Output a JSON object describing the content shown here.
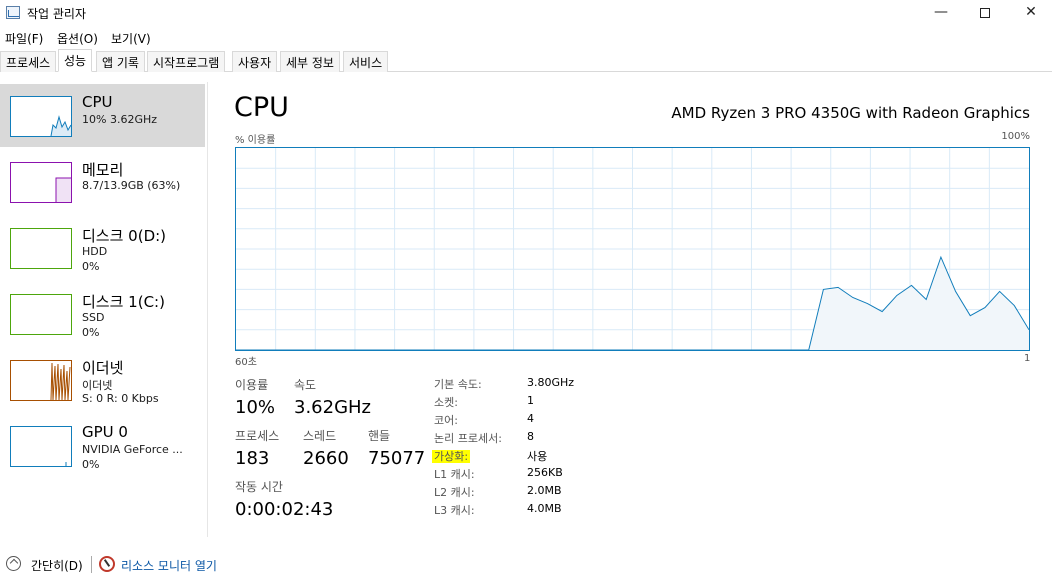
{
  "window": {
    "title": "작업 관리자",
    "controls": {
      "minimize": "—",
      "close": "✕"
    }
  },
  "menu": [
    "파일(F)",
    "옵션(O)",
    "보기(V)"
  ],
  "tabs": [
    "프로세스",
    "성능",
    "앱 기록",
    "시작프로그램",
    "사용자",
    "세부 정보",
    "서비스"
  ],
  "active_tab": "성능",
  "sidebar": {
    "items": [
      {
        "name": "CPU",
        "line1": "10% 3.62GHz",
        "line2": "",
        "color": "#117dbb"
      },
      {
        "name": "메모리",
        "line1": "8.7/13.9GB (63%)",
        "line2": "",
        "color": "#8b12ae"
      },
      {
        "name": "디스크 0(D:)",
        "line1": "HDD",
        "line2": "0%",
        "color": "#4da60c"
      },
      {
        "name": "디스크 1(C:)",
        "line1": "SSD",
        "line2": "0%",
        "color": "#4da60c"
      },
      {
        "name": "이더넷",
        "line1": "이더넷",
        "line2": "S: 0  R: 0 Kbps",
        "color": "#a74f01"
      },
      {
        "name": "GPU 0",
        "line1": "NVIDIA GeForce ...",
        "line2": "0%",
        "color": "#117dbb"
      }
    ]
  },
  "main": {
    "title": "CPU",
    "model": "AMD Ryzen 3 PRO 4350G with Radeon Graphics",
    "graph": {
      "label_left": "% 이용률",
      "label_right": "100%",
      "time_left": "60초",
      "time_right": "1",
      "line_color": "#117dbb",
      "fill_color": "#f1f6fa",
      "grid_color": "#d9eaf7",
      "x_max_seconds": 60,
      "y_max_percent": 100,
      "points": [
        [
          0,
          0
        ],
        [
          39,
          0
        ],
        [
          40,
          30
        ],
        [
          41,
          31
        ],
        [
          42,
          26
        ],
        [
          43,
          23
        ],
        [
          44,
          19
        ],
        [
          45,
          27
        ],
        [
          46,
          32
        ],
        [
          47,
          25
        ],
        [
          48,
          46
        ],
        [
          49,
          29
        ],
        [
          50,
          17
        ],
        [
          51,
          21
        ],
        [
          52,
          29
        ],
        [
          53,
          22
        ],
        [
          54,
          10
        ]
      ]
    },
    "stats": {
      "utilization_label": "이용률",
      "utilization_value": "10%",
      "speed_label": "속도",
      "speed_value": "3.62GHz",
      "process_label": "프로세스",
      "process_value": "183",
      "thread_label": "스레드",
      "thread_value": "2660",
      "handle_label": "핸들",
      "handle_value": "75077",
      "uptime_label": "작동 시간",
      "uptime_value": "0:00:02:43"
    },
    "info": [
      {
        "label": "기본 속도:",
        "value": "3.80GHz"
      },
      {
        "label": "소켓:",
        "value": "1"
      },
      {
        "label": "코어:",
        "value": "4"
      },
      {
        "label": "논리 프로세서:",
        "value": "8"
      },
      {
        "label": "가상화:",
        "value": "사용"
      },
      {
        "label": "L1 캐시:",
        "value": "256KB"
      },
      {
        "label": "L2 캐시:",
        "value": "2.0MB"
      },
      {
        "label": "L3 캐시:",
        "value": "4.0MB"
      }
    ]
  },
  "footer": {
    "less_details": "간단히(D)",
    "resource_monitor": "리소스 모니터 열기"
  }
}
